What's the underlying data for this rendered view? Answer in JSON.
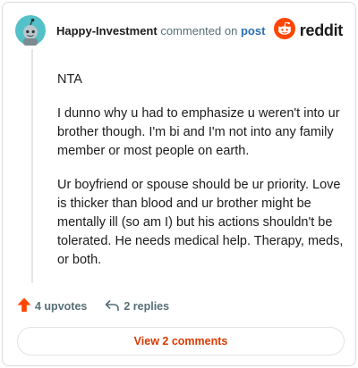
{
  "comment": {
    "username": "Happy-Investment",
    "action_text": "commented on",
    "post_link": "post",
    "paragraphs": [
      "NTA",
      "I dunno why u had to emphasize u weren't into ur brother though. I'm bi and I'm not into any family member or most people on earth.",
      "Ur boyfriend or spouse should be ur priority. Love is thicker than blood and ur brother might be mentally ill (so am I) but his actions shouldn't be tolerated. He needs medical help. Therapy, meds, or both."
    ]
  },
  "brand": {
    "name": "reddit",
    "color": "#ff4500"
  },
  "footer": {
    "upvotes_label": "4 upvotes",
    "replies_label": "2 replies",
    "view_button_label": "View 2 comments"
  },
  "icons": {
    "avatar": "snoo-avatar-icon",
    "brand": "reddit-logo-icon",
    "upvote": "upvote-arrow-icon",
    "reply": "reply-arrow-icon"
  },
  "colors": {
    "upvote": "#ff4500",
    "link": "#2a6fb0",
    "button_text": "#d93a00",
    "muted": "#576f76"
  }
}
